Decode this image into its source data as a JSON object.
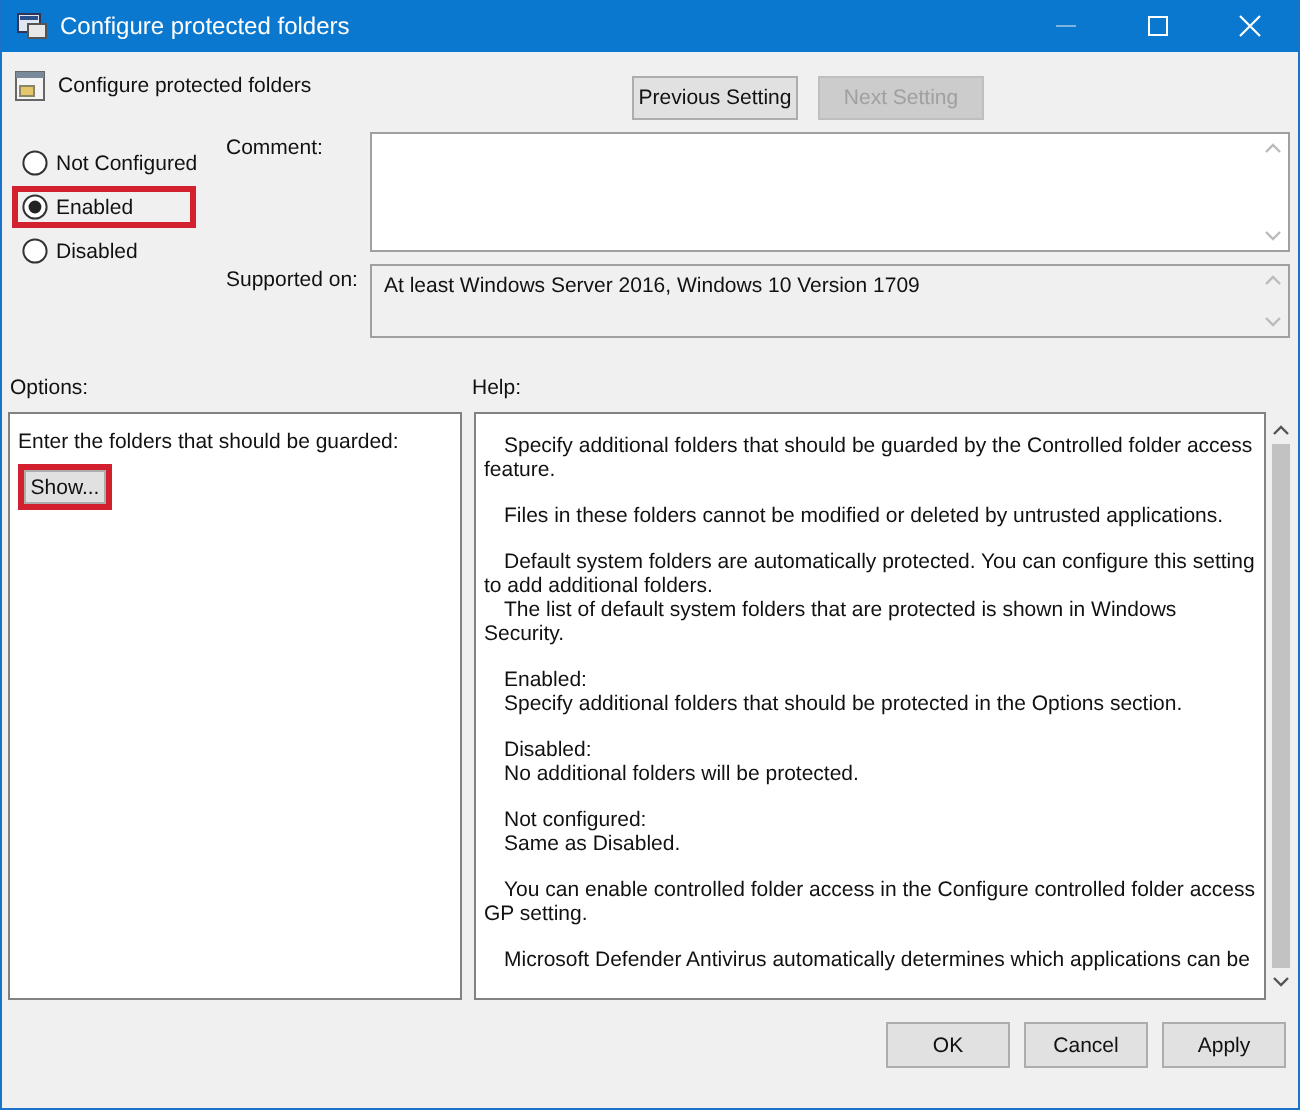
{
  "window": {
    "title": "Configure protected folders"
  },
  "header": {
    "title": "Configure protected folders",
    "buttons": [
      {
        "label": "Previous Setting",
        "disabled": false
      },
      {
        "label": "Next Setting",
        "disabled": true
      }
    ]
  },
  "state_options": [
    {
      "label": "Not Configured",
      "selected": false,
      "highlighted": false
    },
    {
      "label": "Enabled",
      "selected": true,
      "highlighted": true
    },
    {
      "label": "Disabled",
      "selected": false,
      "highlighted": false
    }
  ],
  "comment": {
    "label": "Comment:"
  },
  "supported_on": {
    "label": "Supported on:",
    "value": "At least Windows Server 2016, Windows 10 Version 1709"
  },
  "options": {
    "label": "Options:",
    "prompt": "Enter the folders that should be guarded:",
    "button": {
      "label": "Show...",
      "highlighted": true
    }
  },
  "help": {
    "label": "Help:",
    "paragraphs": [
      [
        "Specify additional folders that should be guarded by the Controlled folder access feature."
      ],
      [
        "Files in these folders cannot be modified or deleted by untrusted applications."
      ],
      [
        "Default system folders are automatically protected. You can configure this setting to add additional folders.",
        "The list of default system folders that are protected is shown in Windows Security."
      ],
      [
        "Enabled:",
        "Specify additional folders that should be protected in the Options section."
      ],
      [
        "Disabled:",
        "No additional folders will be protected."
      ],
      [
        "Not configured:",
        "Same as Disabled."
      ],
      [
        "You can enable controlled folder access in the Configure controlled folder access GP setting."
      ],
      [
        "Microsoft Defender Antivirus automatically determines which applications can be"
      ]
    ]
  },
  "footer": {
    "buttons": [
      {
        "label": "OK"
      },
      {
        "label": "Cancel"
      },
      {
        "label": "Apply"
      }
    ]
  }
}
